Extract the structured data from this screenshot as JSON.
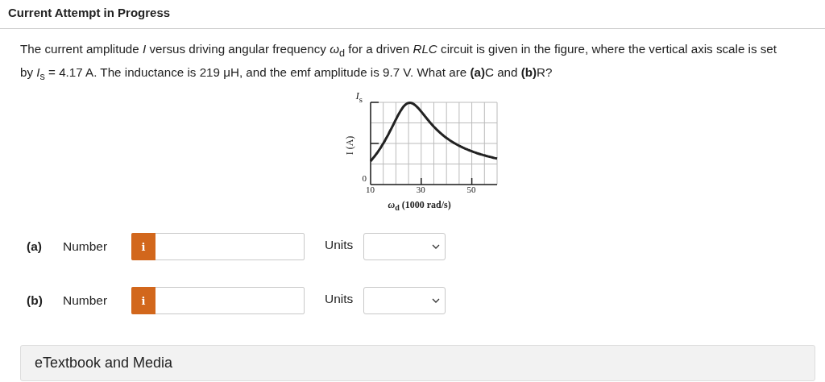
{
  "header": {
    "title": "Current Attempt in Progress"
  },
  "question": "The current amplitude *I* versus driving angular frequency *ω*$_{d}$ for a driven *RLC* circuit is given in the figure, where the vertical axis scale is set by *I*$_{s}$ = 4.17 A. The inductance is 219 μH, and the emf amplitude is 9.7 V. What are **(a)**C and **(b)**R?",
  "figure": {
    "ylabel": "I (A)",
    "y_top_label": "*I*$_{s}$",
    "y_zero_label": "0",
    "x_tick_labels": [
      "10",
      "30",
      "50"
    ],
    "xlabel": "*ω*$_{d}$ (1000 rad/s)"
  },
  "answers": [
    {
      "part": "(a)",
      "label": "Number",
      "info_icon": "i",
      "units_label": "Units"
    },
    {
      "part": "(b)",
      "label": "Number",
      "info_icon": "i",
      "units_label": "Units"
    }
  ],
  "resources": {
    "label": "eTextbook and Media"
  }
}
